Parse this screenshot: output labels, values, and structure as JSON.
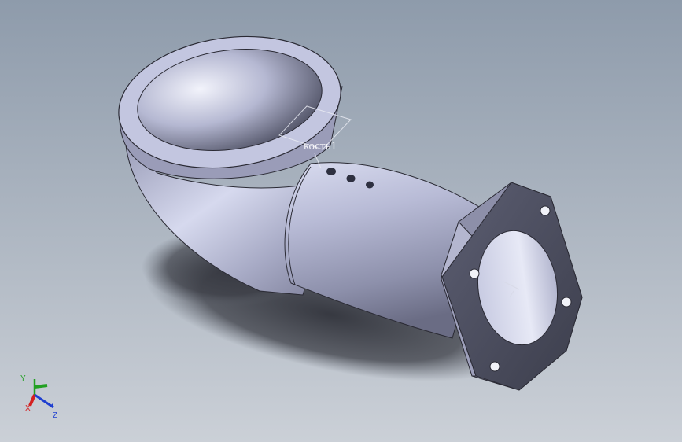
{
  "viewport": {
    "background_top": "#8e9bab",
    "background_bottom": "#c9ced5"
  },
  "model": {
    "part_name": "elbow-pipe-with-hex-flange",
    "body_color": "#aeb0cc",
    "flange_color": "#a3a5c0",
    "shadow_color": "#3a3c44"
  },
  "plane_label": {
    "text": "кость1"
  },
  "triad": {
    "x_label": "X",
    "y_label": "Y",
    "z_label": "Z",
    "x_color": "#d42020",
    "y_color": "#22a022",
    "z_color": "#1f3fd0"
  }
}
